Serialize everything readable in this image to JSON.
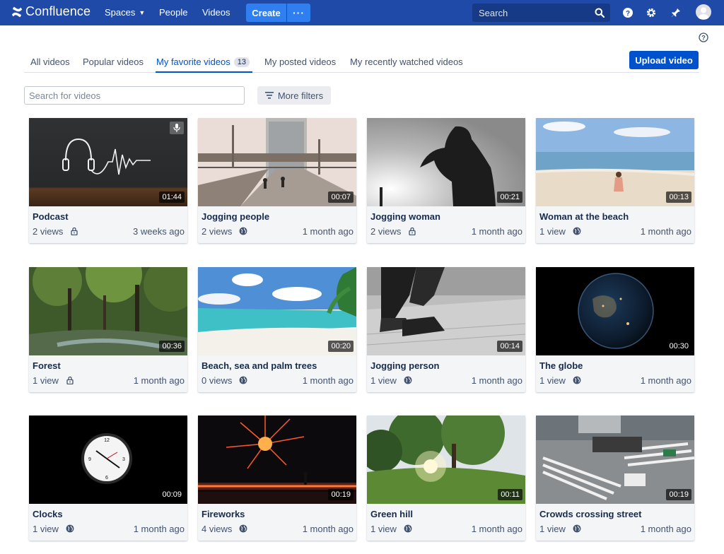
{
  "nav": {
    "brand": "Confluence",
    "spaces": "Spaces",
    "people": "People",
    "videos": "Videos",
    "create": "Create",
    "more": "···",
    "search_placeholder": "Search"
  },
  "tabs": {
    "all": "All videos",
    "popular": "Popular videos",
    "favorite": "My favorite videos",
    "favorite_count": "13",
    "posted": "My posted videos",
    "recent": "My recently watched videos"
  },
  "upload_label": "Upload video",
  "filters": {
    "search_placeholder": "Search for videos",
    "more_filters": "More filters"
  },
  "colors": {
    "nav_bg": "#1f4aa8",
    "primary": "#0052cc",
    "create_bg": "#2f7ff0"
  },
  "videos": [
    {
      "title": "Podcast",
      "views": "2 views",
      "visibility": "lock-icon",
      "age": "3 weeks ago",
      "duration": "01:44",
      "audio": true
    },
    {
      "title": "Jogging people",
      "views": "2 views",
      "visibility": "globe-icon",
      "age": "1 month ago",
      "duration": "00:07"
    },
    {
      "title": "Jogging woman",
      "views": "2 views",
      "visibility": "lock-icon",
      "age": "1 month ago",
      "duration": "00:21"
    },
    {
      "title": "Woman at the beach",
      "views": "1 view",
      "visibility": "globe-icon",
      "age": "1 month ago",
      "duration": "00:13"
    },
    {
      "title": "Forest",
      "views": "1 view",
      "visibility": "lock-icon",
      "age": "1 month ago",
      "duration": "00:36"
    },
    {
      "title": "Beach, sea and palm trees",
      "views": "0 views",
      "visibility": "globe-icon",
      "age": "1 month ago",
      "duration": "00:20"
    },
    {
      "title": "Jogging person",
      "views": "1 view",
      "visibility": "globe-icon",
      "age": "1 month ago",
      "duration": "00:14"
    },
    {
      "title": "The globe",
      "views": "1 view",
      "visibility": "globe-icon",
      "age": "1 month ago",
      "duration": "00:30"
    },
    {
      "title": "Clocks",
      "views": "1 view",
      "visibility": "globe-icon",
      "age": "1 month ago",
      "duration": "00:09"
    },
    {
      "title": "Fireworks",
      "views": "4 views",
      "visibility": "globe-icon",
      "age": "1 month ago",
      "duration": "00:19"
    },
    {
      "title": "Green hill",
      "views": "1 view",
      "visibility": "globe-icon",
      "age": "1 month ago",
      "duration": "00:11"
    },
    {
      "title": "Crowds crossing street",
      "views": "1 view",
      "visibility": "globe-icon",
      "age": "1 month ago",
      "duration": "00:19"
    }
  ]
}
